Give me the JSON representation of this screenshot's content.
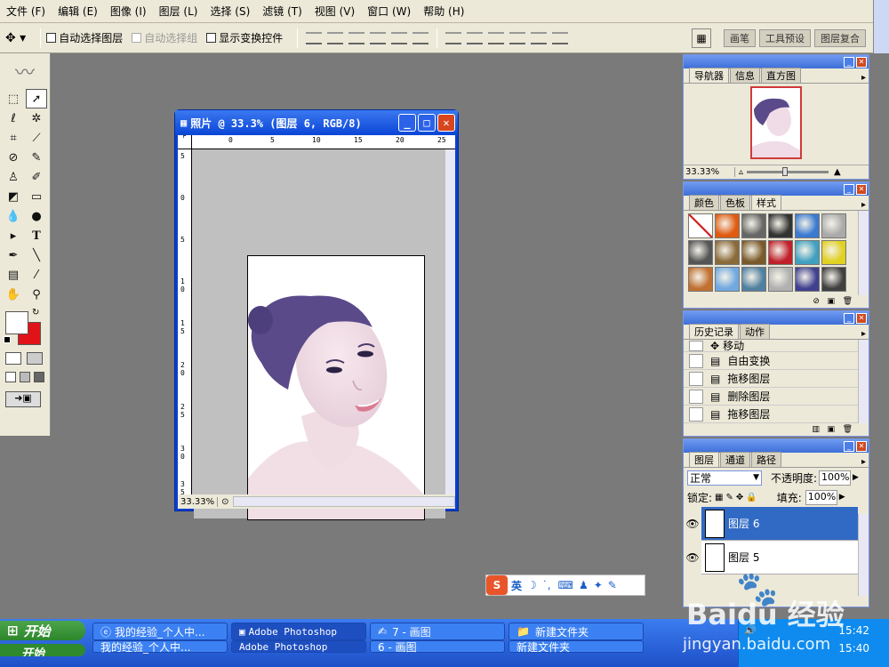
{
  "menu": [
    "文件 (F)",
    "编辑 (E)",
    "图像 (I)",
    "图层 (L)",
    "选择 (S)",
    "滤镜 (T)",
    "视图 (V)",
    "窗口 (W)",
    "帮助 (H)"
  ],
  "options": {
    "auto_select_layer": "自动选择图层",
    "auto_select_group": "自动选择组",
    "show_transform": "显示变换控件",
    "well_tabs": [
      "画笔",
      "工具预设",
      "图层复合"
    ]
  },
  "document": {
    "title": "照片 @ 33.3% (图层 6, RGB/8)",
    "zoom": "33.33%",
    "ruler_top": [
      "0",
      "5",
      "10",
      "15",
      "20",
      "25"
    ],
    "ruler_left": [
      "5",
      "0",
      "5",
      "10",
      "15",
      "20",
      "25",
      "30",
      "35"
    ]
  },
  "navigator": {
    "tabs": [
      "导航器",
      "信息",
      "直方图"
    ],
    "zoom": "33.33%"
  },
  "styles_panel": {
    "tabs": [
      "颜色",
      "色板",
      "样式"
    ],
    "swatches": [
      "#ffffff",
      "#e05a10",
      "#666666",
      "#333333",
      "#3a7ad0",
      "#aaaaaa",
      "#555555",
      "#8a6a3a",
      "#7a5a2a",
      "#c0202a",
      "#40a0c0",
      "#e0d020",
      "#c07030",
      "#70a8e0",
      "#5080a0",
      "#b0b0b0",
      "#404090",
      "#404040"
    ]
  },
  "history": {
    "tabs": [
      "历史记录",
      "动作"
    ],
    "items": [
      "移动",
      "自由变换",
      "拖移图层",
      "删除图层",
      "拖移图层"
    ]
  },
  "layers": {
    "tabs": [
      "图层",
      "通道",
      "路径"
    ],
    "blend_mode": "正常",
    "opacity_label": "不透明度:",
    "opacity": "100%",
    "lock_label": "锁定:",
    "fill_label": "填充:",
    "fill": "100%",
    "items": [
      "图层 6",
      "图层 5"
    ]
  },
  "ime": {
    "label": "英"
  },
  "taskbar": {
    "start": "开始",
    "row1": [
      "我的经验_个人中...",
      "Adobe Photoshop",
      "7 - 画图",
      "新建文件夹"
    ],
    "row2": [
      "我的经验_个人中...",
      "Adobe Photoshop",
      "6 - 画图",
      "新建文件夹"
    ],
    "clock1": "15:42",
    "clock2": "15:40"
  },
  "watermark": {
    "brand": "Baidu 经验",
    "url": "jingyan.baidu.com"
  }
}
